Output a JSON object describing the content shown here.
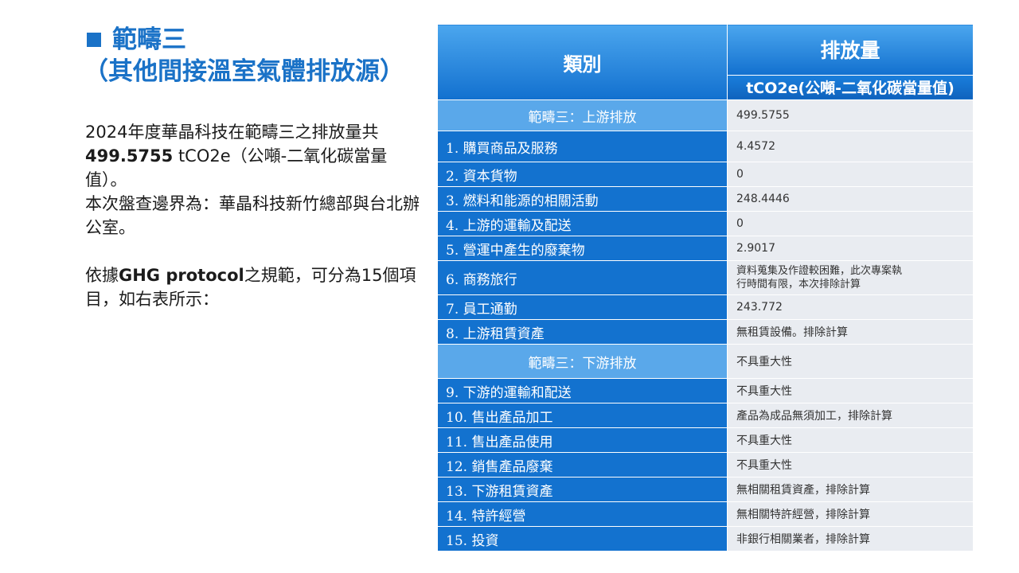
{
  "heading": {
    "line1": "範疇三",
    "line2": "（其他間接溫室氣體排放源）"
  },
  "body": {
    "p1_a": "2024年度華晶科技在範疇三之排放量共",
    "p1_b": "499.5755",
    "p1_c": " tCO2e（公噸-二氧化碳當量值）。",
    "p2": "本次盤查邊界為：華晶科技新竹總部與台北辦公室。",
    "p3_a": "依據",
    "p3_b": "GHG protocol",
    "p3_c": "之規範，可分為15個項目，如右表所示："
  },
  "table": {
    "header_category": "類別",
    "header_amount": "排放量",
    "header_unit": "tCO2e(公噸-二氧化碳當量值)",
    "upstream_title": "範疇三：上游排放",
    "upstream_total": "499.5755",
    "downstream_title": "範疇三：下游排放",
    "downstream_value": "不具重大性",
    "rows": [
      {
        "category": "1. 購買商品及服務",
        "value": "4.4572"
      },
      {
        "category": "2. 資本貨物",
        "value": "0"
      },
      {
        "category": "3. 燃料和能源的相關活動",
        "value": "248.4446"
      },
      {
        "category": "4. 上游的運輸及配送",
        "value": "0"
      },
      {
        "category": "5. 營運中產生的廢棄物",
        "value": "2.9017"
      },
      {
        "category": "6. 商務旅行",
        "value_line1": "資料蒐集及作證較困難，此次專案執",
        "value_line2": "行時間有限，本次排除計算"
      },
      {
        "category": "7. 員工通勤",
        "value": "243.772"
      },
      {
        "category": "8. 上游租賃資產",
        "value": "無租賃設備。排除計算"
      },
      {
        "category": "9. 下游的運輸和配送",
        "value": "不具重大性"
      },
      {
        "category": "10. 售出產品加工",
        "value": "產品為成品無須加工，排除計算"
      },
      {
        "category": "11. 售出產品使用",
        "value": "不具重大性"
      },
      {
        "category": "12. 銷售產品廢棄",
        "value": "不具重大性"
      },
      {
        "category": "13. 下游租賃資產",
        "value": "無相關租賃資產，排除計算"
      },
      {
        "category": "14. 特許經營",
        "value": "無相關特許經營，排除計算"
      },
      {
        "category": "15. 投資",
        "value": "非銀行相關業者，排除計算"
      }
    ]
  },
  "colors": {
    "accent": "#1a72c7",
    "header_blue": "#1270cf",
    "scope_row": "#5aa8ea",
    "category_cell": "#1372cf",
    "value_cell": "#e9ecf1"
  }
}
